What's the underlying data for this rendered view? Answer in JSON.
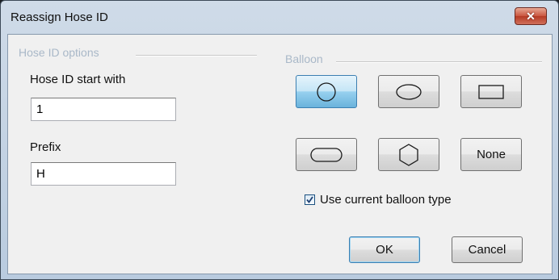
{
  "window": {
    "title": "Reassign Hose ID",
    "close_icon": "close-icon"
  },
  "hose_id_options": {
    "group_label": "Hose ID options",
    "start_label": "Hose ID start with",
    "start_value": "1",
    "prefix_label": "Prefix",
    "prefix_value": "H"
  },
  "balloon": {
    "group_label": "Balloon",
    "shapes": [
      {
        "name": "circle",
        "selected": true
      },
      {
        "name": "ellipse",
        "selected": false
      },
      {
        "name": "rectangle",
        "selected": false
      },
      {
        "name": "rounded-rectangle",
        "selected": false
      },
      {
        "name": "hexagon",
        "selected": false
      },
      {
        "name": "none",
        "label": "None",
        "selected": false
      }
    ],
    "use_current_label": "Use current balloon type",
    "use_current_checked": true
  },
  "buttons": {
    "ok_label": "OK",
    "cancel_label": "Cancel"
  },
  "colors": {
    "selected_button": "#98d1ef",
    "close_button": "#c9553f",
    "group_label": "#a9b8c8"
  }
}
